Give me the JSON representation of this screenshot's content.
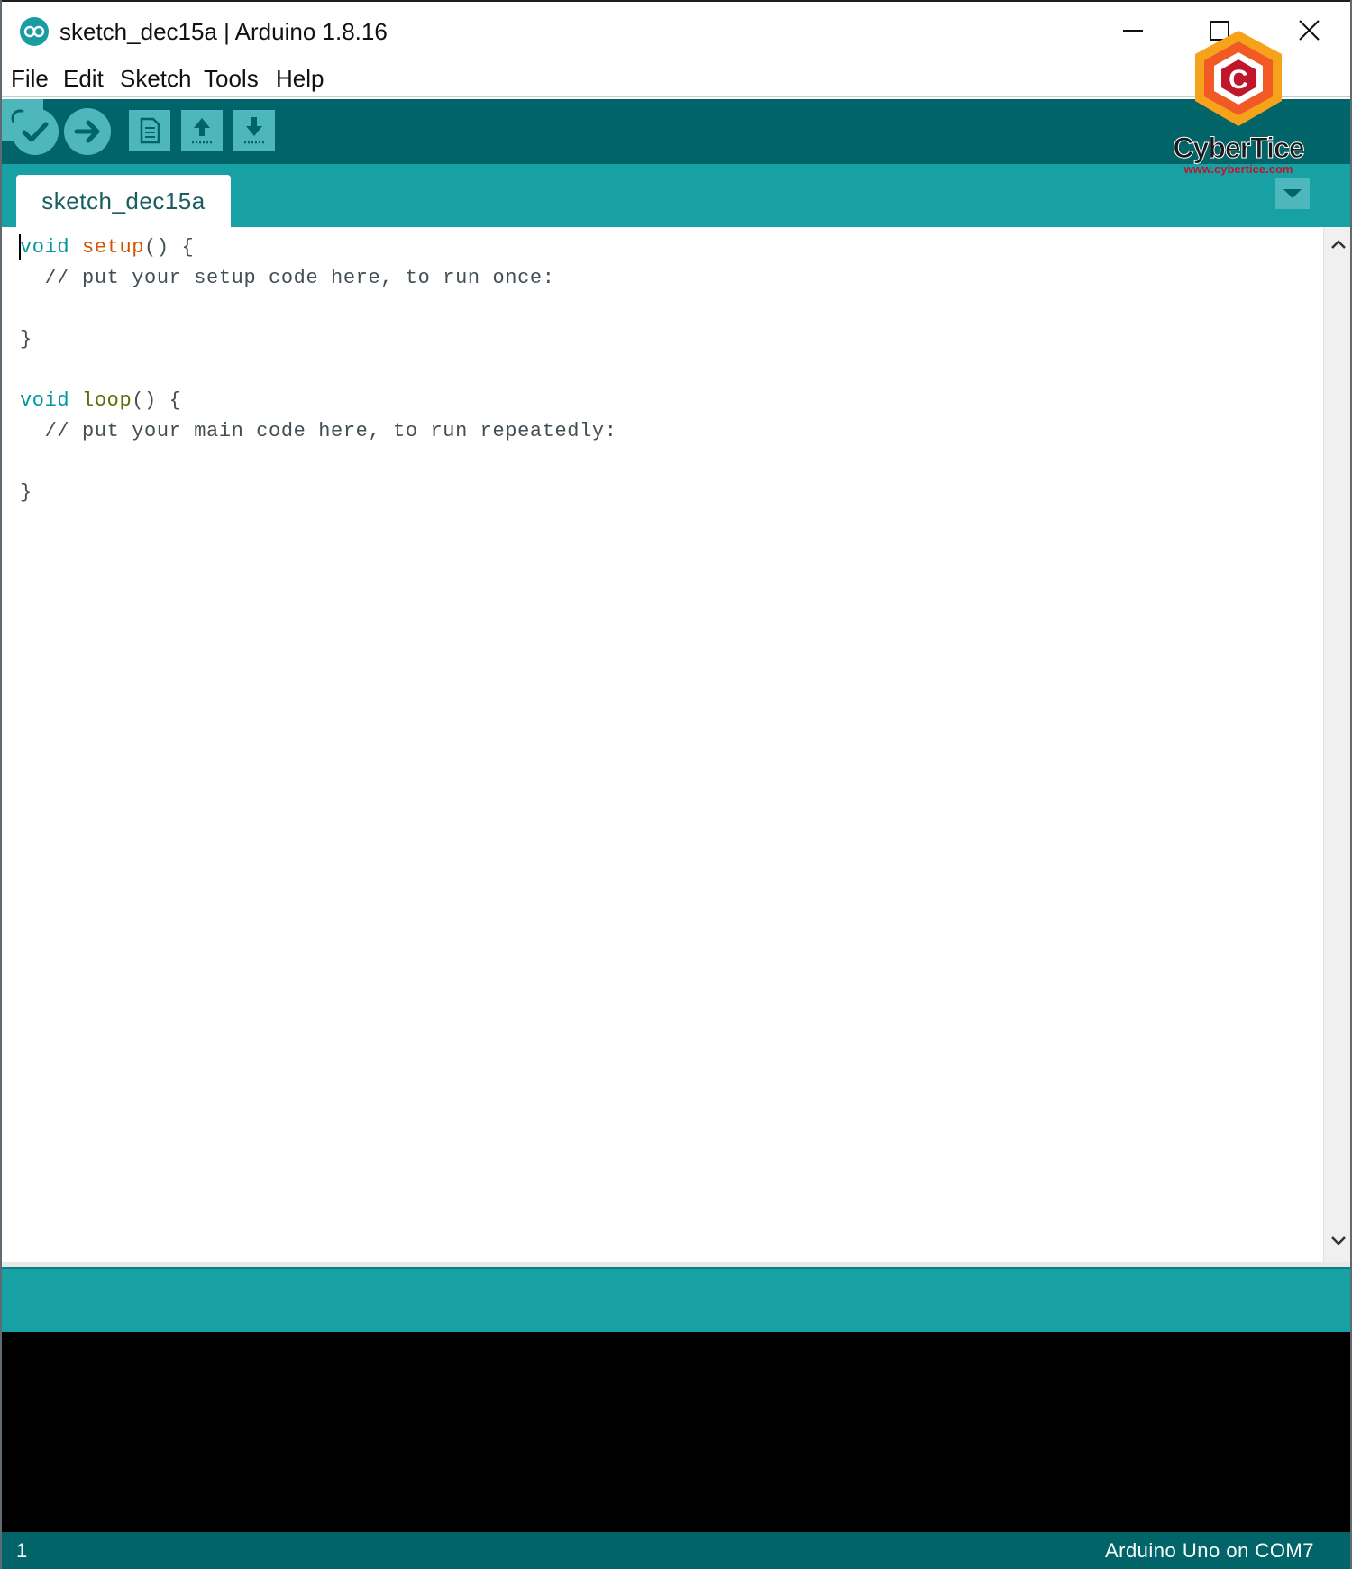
{
  "window": {
    "title": "sketch_dec15a | Arduino 1.8.16"
  },
  "menu": {
    "items": [
      {
        "label": "File"
      },
      {
        "label": "Edit"
      },
      {
        "label": "Sketch"
      },
      {
        "label": "Tools"
      },
      {
        "label": "Help"
      }
    ]
  },
  "toolbar": {
    "icons": [
      "verify-check-icon",
      "upload-arrow-icon",
      "new-sketch-icon",
      "open-arrow-up-icon",
      "save-arrow-down-icon",
      "serial-monitor-magnifier-icon"
    ]
  },
  "tabs": [
    {
      "label": "sketch_dec15a",
      "active": true
    }
  ],
  "editor": {
    "lines": [
      {
        "kw": "void",
        "fn": "setup",
        "rest": "() {"
      },
      {
        "comment": "  // put your setup code here, to run once:"
      },
      {
        "text": ""
      },
      {
        "text": "}"
      },
      {
        "text": ""
      },
      {
        "kw": "void",
        "fn": "loop",
        "rest": "() {"
      },
      {
        "comment": "  // put your main code here, to run repeatedly:"
      },
      {
        "text": ""
      },
      {
        "text": "}"
      }
    ]
  },
  "status": {
    "line_number": "1",
    "board": "Arduino Uno on COM7"
  },
  "watermark": {
    "brand": "CyberTice",
    "url": "www.cybertice.com",
    "letter": "C"
  },
  "colors": {
    "toolbar": "#006468",
    "tabbar": "#17a1a5",
    "button": "#4db7bb",
    "keyword": "#00979c",
    "function": "#d35400"
  }
}
